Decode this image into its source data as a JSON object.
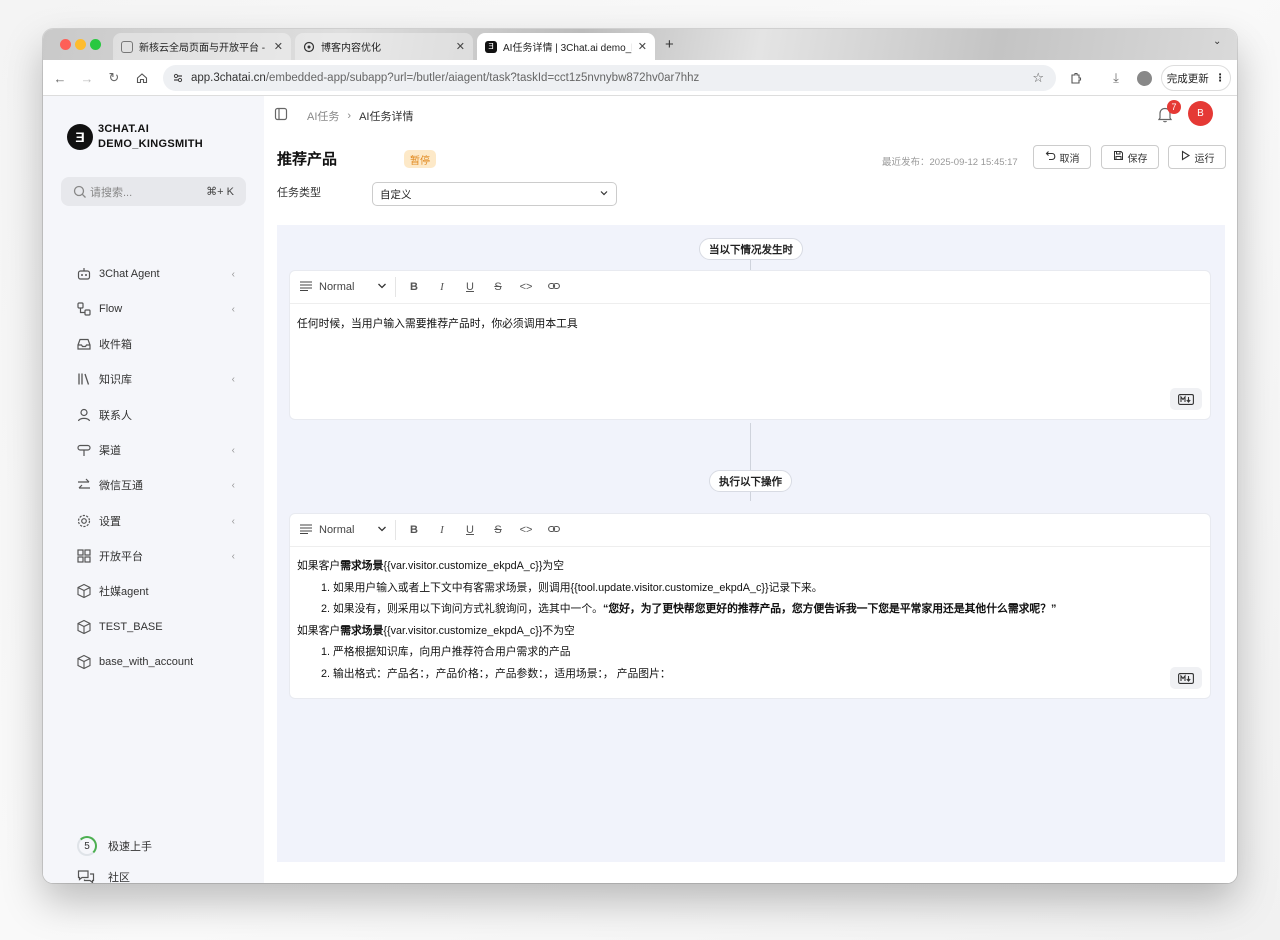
{
  "browser": {
    "tabs": [
      {
        "title": "新核云全局页面与开放平台 - ",
        "active": false
      },
      {
        "title": "博客内容优化",
        "active": false
      },
      {
        "title": "AI任务详情 | 3Chat.ai demo_k",
        "active": true
      }
    ],
    "url_host": "app.3chatai.cn",
    "url_path": "/embedded-app/subapp?url=/butler/aiagent/task?taskId=cct1z5nvnybw872hv0ar7hhz",
    "update_label": "完成更新"
  },
  "sidebar": {
    "brand_line1": "3CHAT.AI",
    "brand_line2": "DEMO_KINGSMITH",
    "search_placeholder": "请搜索...",
    "search_shortcut": "⌘+ K",
    "items": [
      {
        "label": "3Chat Agent",
        "icon": "robot-icon",
        "expandable": true
      },
      {
        "label": "Flow",
        "icon": "flow-icon",
        "expandable": true
      },
      {
        "label": "收件箱",
        "icon": "inbox-icon",
        "expandable": false
      },
      {
        "label": "知识库",
        "icon": "books-icon",
        "expandable": true
      },
      {
        "label": "联系人",
        "icon": "user-icon",
        "expandable": false
      },
      {
        "label": "渠道",
        "icon": "signpost-icon",
        "expandable": true
      },
      {
        "label": "微信互通",
        "icon": "swap-icon",
        "expandable": true
      },
      {
        "label": "设置",
        "icon": "gear-icon",
        "expandable": true
      },
      {
        "label": "开放平台",
        "icon": "grid-icon",
        "expandable": true
      },
      {
        "label": "社媒agent",
        "icon": "cube-icon",
        "expandable": false
      },
      {
        "label": "TEST_BASE",
        "icon": "cube-icon",
        "expandable": false
      },
      {
        "label": "base_with_account",
        "icon": "cube-icon",
        "expandable": false
      }
    ],
    "quickstart_count": "5",
    "quickstart_label": "极速上手",
    "community_label": "社区"
  },
  "header": {
    "breadcrumb_parent": "AI任务",
    "breadcrumb_current": "AI任务详情",
    "notification_count": "7",
    "avatar_initial": "B"
  },
  "task": {
    "title": "推荐产品",
    "status": "暂停",
    "published": "最近发布：2025-09-12 15:45:17",
    "cancel_label": "取消",
    "save_label": "保存",
    "run_label": "运行",
    "type_label": "任务类型",
    "type_value": "自定义"
  },
  "flow": {
    "trigger_label": "当以下情况发生时",
    "action_label": "执行以下操作",
    "format_label": "Normal",
    "trigger_text": "任何时候，当用户输入需要推荐产品时，你必须调用本工具",
    "action": {
      "l1_pre": "如果客户",
      "l1_bold": "需求场景",
      "l1_post": "{{var.visitor.customize_ekpdA_c}}为空",
      "l2": "1. 如果用户输入或者上下文中有客需求场景，则调用{{tool.update.visitor.customize_ekpdA_c}}记录下来。",
      "l3_pre": "2. 如果没有，则采用以下询问方式礼貌询问，选其中一个。",
      "l3_bold": "“您好，为了更快帮您更好的推荐产品，您方便告诉我一下您是平常家用还是其他什么需求呢？”",
      "l4_pre": "如果客户",
      "l4_bold": "需求场景",
      "l4_post": "{{var.visitor.customize_ekpdA_c}}不为空",
      "l5": "1. 严格根据知识库，向用户推荐符合用户需求的产品",
      "l6": "2. 输出格式：产品名：，产品价格：，产品参数：，适用场景：， 产品图片："
    }
  },
  "colors": {
    "accent": "#e53935",
    "status_bg": "#fde9c8",
    "status_fg": "#e0861a",
    "canvas": "#f1f3fb"
  }
}
